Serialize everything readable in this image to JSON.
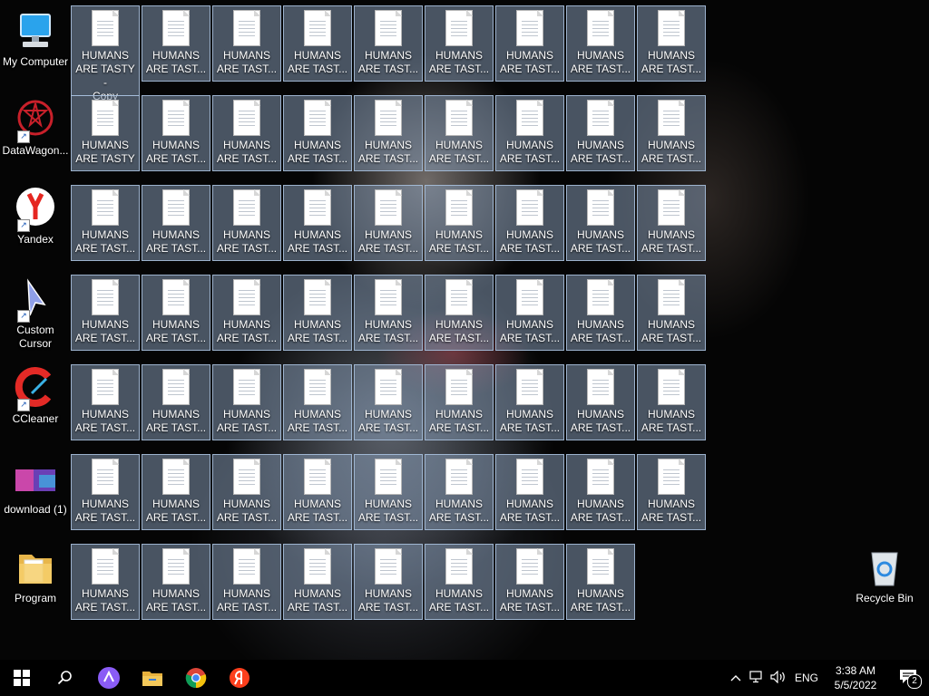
{
  "desktop": {
    "icons": [
      {
        "label": "My Computer",
        "icon": "computer-icon"
      },
      {
        "label": "DataWagon...",
        "icon": "datawagon-icon"
      },
      {
        "label": "Yandex",
        "icon": "yandex-browser-icon"
      },
      {
        "label": "Custom\nCursor",
        "icon": "custom-cursor-icon"
      },
      {
        "label": "CCleaner",
        "icon": "ccleaner-icon"
      },
      {
        "label": "download (1)",
        "icon": "image-file-icon"
      },
      {
        "label": "Program",
        "icon": "folder-icon"
      }
    ],
    "recycle_bin": {
      "label": "Recycle Bin",
      "icon": "recycle-bin-icon"
    },
    "files": {
      "first_label": "HUMANS\nARE TASTY -\nCopy",
      "second_label": "HUMANS\nARE TASTY",
      "truncated_label": "HUMANS\nARE TAST..."
    }
  },
  "taskbar": {
    "start_icon": "windows-start-icon",
    "search_icon": "search-icon",
    "alice_icon": "yandex-alice-icon",
    "explorer_icon": "file-explorer-icon",
    "chrome_icon": "chrome-icon",
    "yandex_icon": "yandex-icon",
    "tray": {
      "chevron_icon": "chevron-up-icon",
      "network_icon": "network-icon",
      "volume_icon": "volume-icon",
      "language": "ENG",
      "time": "3:38 AM",
      "date": "5/5/2022",
      "notification_count": "2"
    }
  }
}
